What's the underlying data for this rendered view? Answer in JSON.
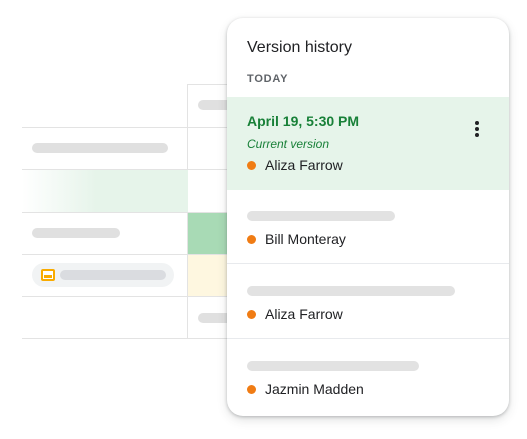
{
  "panel": {
    "title": "Version history",
    "section": "TODAY",
    "current_version": {
      "timestamp": "April 19, 5:30 PM",
      "status": "Current version",
      "author": "Aliza Farrow",
      "author_color": "#f07c14",
      "menu_icon": "more-vert-icon"
    },
    "versions": [
      {
        "author": "Bill Monteray",
        "author_color": "#f07c14"
      },
      {
        "author": "Aliza Farrow",
        "author_color": "#f07c14"
      },
      {
        "author": "Jazmin Madden",
        "author_color": "#f07c14"
      }
    ]
  },
  "colors": {
    "current_bg": "#e6f4ea",
    "accent_green": "#188038",
    "cell_green": "#a8dab5",
    "cell_yellow": "#fef7e0",
    "chip_icon": "#f9ab00"
  },
  "sheet": {
    "chip_icon": "slides-icon"
  }
}
